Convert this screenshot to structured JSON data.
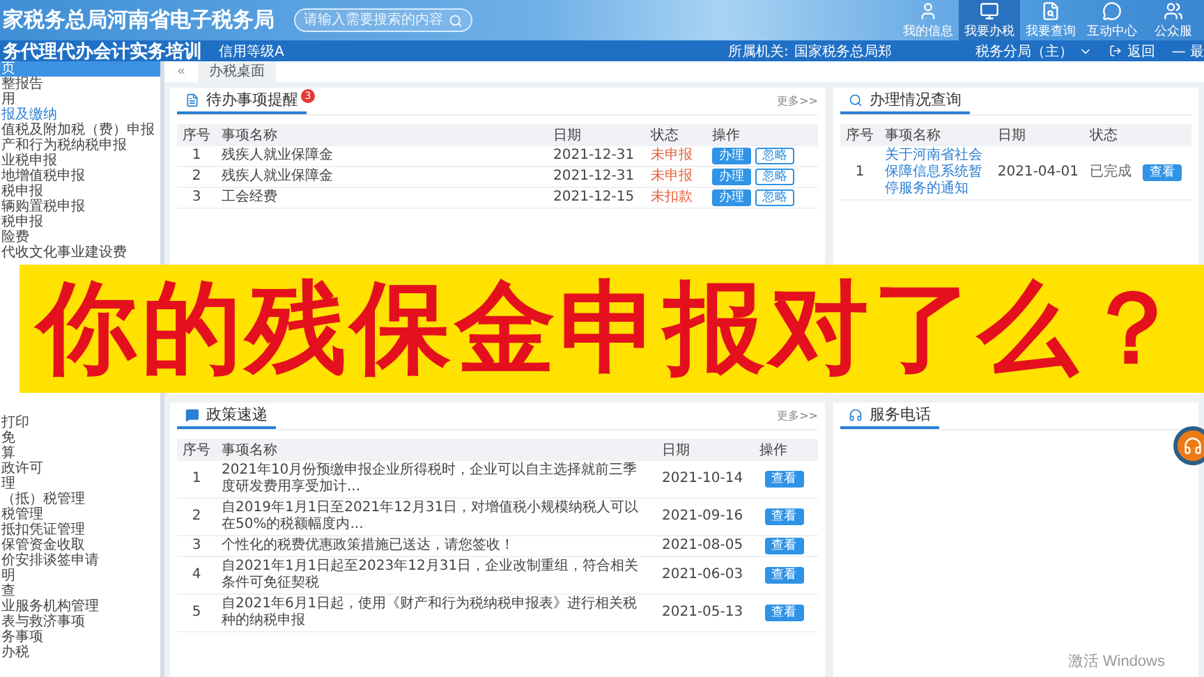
{
  "header": {
    "title": "家税务总局河南省电子税务局",
    "search": {
      "placeholder": "请输入需要搜索的内容"
    },
    "nav": [
      {
        "label": "我的信息",
        "selected": false
      },
      {
        "label": "我要办税",
        "selected": true
      },
      {
        "label": "我要查询",
        "selected": false
      },
      {
        "label": "互动中心",
        "selected": false
      },
      {
        "label": "公众服",
        "selected": false
      }
    ]
  },
  "subbar": {
    "company": "务代理代办会计实务培训",
    "credit": "信用等级A",
    "authority_label": "所属机关:",
    "authority": "国家税务总局郑",
    "authority_tail": "税务分局（主）",
    "back": "返回",
    "more": "— 最"
  },
  "sidebar": {
    "upper_items": [
      {
        "label": "页",
        "kind": "item",
        "selected": true
      },
      {
        "label": "整报告",
        "kind": "item",
        "selected": false
      },
      {
        "label": "用",
        "kind": "item",
        "selected": false
      },
      {
        "label": "报及缴纳",
        "kind": "group",
        "selected": false
      },
      {
        "label": "值税及附加税（费）申报",
        "kind": "item",
        "selected": false
      },
      {
        "label": "产和行为税纳税申报",
        "kind": "item",
        "selected": false
      },
      {
        "label": "业税申报",
        "kind": "item",
        "selected": false
      },
      {
        "label": "地增值税申报",
        "kind": "item",
        "selected": false
      },
      {
        "label": "税申报",
        "kind": "item",
        "selected": false
      },
      {
        "label": "辆购置税申报",
        "kind": "item",
        "selected": false
      },
      {
        "label": "税申报",
        "kind": "item",
        "selected": false
      },
      {
        "label": "险费",
        "kind": "item",
        "selected": false
      },
      {
        "label": "代收文化事业建设费",
        "kind": "item",
        "selected": false
      }
    ],
    "lower_items": [
      {
        "label": "打印",
        "kind": "item",
        "selected": false
      },
      {
        "label": "免",
        "kind": "item",
        "selected": false
      },
      {
        "label": "算",
        "kind": "item",
        "selected": false
      },
      {
        "label": "政许可",
        "kind": "item",
        "selected": false
      },
      {
        "label": "理",
        "kind": "item",
        "selected": false
      },
      {
        "label": "（抵）税管理",
        "kind": "item",
        "selected": false
      },
      {
        "label": "税管理",
        "kind": "item",
        "selected": false
      },
      {
        "label": "抵扣凭证管理",
        "kind": "item",
        "selected": false
      },
      {
        "label": "保管资金收取",
        "kind": "item",
        "selected": false
      },
      {
        "label": "价安排谈签申请",
        "kind": "item",
        "selected": false
      },
      {
        "label": "明",
        "kind": "item",
        "selected": false
      },
      {
        "label": "查",
        "kind": "item",
        "selected": false
      },
      {
        "label": "业服务机构管理",
        "kind": "item",
        "selected": false
      },
      {
        "label": "表与救济事项",
        "kind": "item",
        "selected": false
      },
      {
        "label": "务事项",
        "kind": "item",
        "selected": false
      },
      {
        "label": "办税",
        "kind": "item",
        "selected": false
      }
    ]
  },
  "tabs": {
    "collapse": "«",
    "items": [
      {
        "label": "办税桌面",
        "selected": true
      }
    ]
  },
  "todo": {
    "title": "待办事项提醒",
    "badge": "3",
    "more": "更多>>",
    "columns": [
      "序号",
      "事项名称",
      "日期",
      "状态",
      "操作"
    ],
    "rows": [
      {
        "no": "1",
        "name": "残疾人就业保障金",
        "date": "2021-12-31",
        "status": "未申报",
        "actions": [
          "办理",
          "忽略"
        ]
      },
      {
        "no": "2",
        "name": "残疾人就业保障金",
        "date": "2021-12-31",
        "status": "未申报",
        "actions": [
          "办理",
          "忽略"
        ]
      },
      {
        "no": "3",
        "name": "工会经费",
        "date": "2021-12-15",
        "status": "未扣款",
        "actions": [
          "办理",
          "忽略"
        ]
      }
    ]
  },
  "progress": {
    "title": "办理情况查询",
    "columns": [
      "序号",
      "事项名称",
      "日期",
      "状态"
    ],
    "rows": [
      {
        "no": "1",
        "name": "关于河南省社会保障信息系统暂停服务的通知",
        "date": "2021-04-01",
        "status": "已完成",
        "action": "查看"
      }
    ]
  },
  "banner": {
    "text": "你的残保金申报对了么？"
  },
  "policy": {
    "title": "政策速递",
    "more": "更多>>",
    "columns": [
      "序号",
      "事项名称",
      "日期",
      "操作"
    ],
    "rows": [
      {
        "no": "1",
        "name": "2021年10月份预缴申报企业所得税时，企业可以自主选择就前三季度研发费用享受加计...",
        "date": "2021-10-14",
        "action": "查看"
      },
      {
        "no": "2",
        "name": "自2019年1月1日至2021年12月31日，对增值税小规模纳税人可以在50%的税额幅度内...",
        "date": "2021-09-16",
        "action": "查看"
      },
      {
        "no": "3",
        "name": "个性化的税费优惠政策措施已送达，请您签收！",
        "date": "2021-08-05",
        "action": "查看"
      },
      {
        "no": "4",
        "name": "自2021年1月1日起至2023年12月31日，企业改制重组，符合相关条件可免征契税",
        "date": "2021-06-03",
        "action": "查看"
      },
      {
        "no": "5",
        "name": "自2021年6月1日起，使用《财产和行为税纳税申报表》进行相关税种的纳税申报",
        "date": "2021-05-13",
        "action": "查看"
      }
    ]
  },
  "service": {
    "title": "服务电话"
  },
  "os_notice": "激活 Windows"
}
